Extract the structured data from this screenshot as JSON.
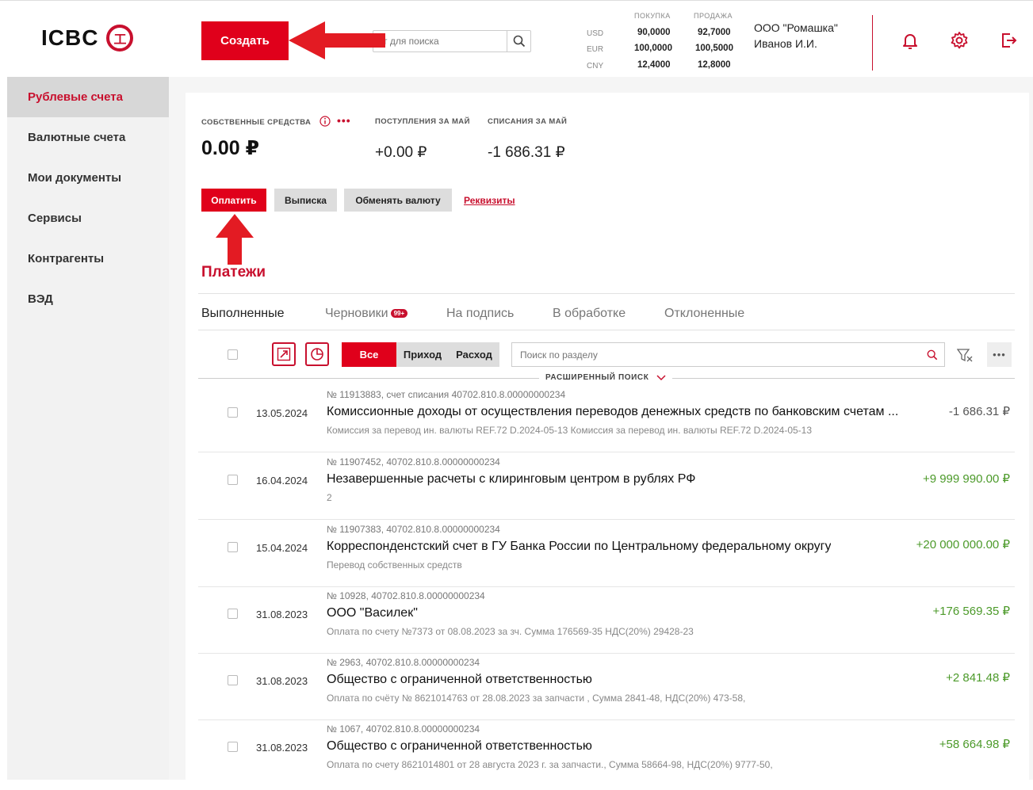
{
  "header": {
    "logo_text": "ICBC",
    "logo_mark": "工",
    "create_label": "Создать",
    "search_placeholder": "т для поиска",
    "rates": {
      "buy_label": "ПОКУПКА",
      "sell_label": "ПРОДАЖА",
      "rows": [
        {
          "currency": "USD",
          "buy": "90,0000",
          "sell": "92,7000"
        },
        {
          "currency": "EUR",
          "buy": "100,0000",
          "sell": "100,5000"
        },
        {
          "currency": "CNY",
          "buy": "12,4000",
          "sell": "12,8000"
        }
      ]
    },
    "company": "ООО \"Ромашка\"",
    "user": "Иванов И.И.",
    "icons": [
      "bell-icon",
      "gear-icon",
      "logout-icon"
    ]
  },
  "sidebar": {
    "items": [
      {
        "label": "Рублевые счета",
        "active": true
      },
      {
        "label": "Валютные счета",
        "active": false
      },
      {
        "label": "Мои документы",
        "active": false
      },
      {
        "label": "Сервисы",
        "active": false
      },
      {
        "label": "Контрагенты",
        "active": false
      },
      {
        "label": "ВЭД",
        "active": false
      }
    ]
  },
  "summary": {
    "own_funds_label": "СОБСТВЕННЫЕ СРЕДСТВА",
    "own_funds_value": "0.00 ₽",
    "income_label": "ПОСТУПЛЕНИЯ ЗА МАЙ",
    "income_value": "+0.00 ₽",
    "outcome_label": "СПИСАНИЯ ЗА МАЙ",
    "outcome_value": "-1 686.31 ₽",
    "more_dots": "•••"
  },
  "actions": {
    "pay": "Оплатить",
    "statement": "Выписка",
    "exchange": "Обменять валюту",
    "requisites": "Реквизиты"
  },
  "payments": {
    "title": "Платежи",
    "tabs": [
      {
        "label": "Выполненные",
        "active": true
      },
      {
        "label": "Черновики",
        "badge": "99+"
      },
      {
        "label": "На подпись"
      },
      {
        "label": "В обработке"
      },
      {
        "label": "Отклоненные"
      }
    ],
    "filter_all": "Все",
    "filter_income": "Приход",
    "filter_outcome": "Расход",
    "section_search_placeholder": "Поиск по разделу",
    "advanced_search": "РАСШИРЕННЫЙ ПОИСК",
    "rows": [
      {
        "number": "№ 11913883, счет списания 40702.810.8.00000000234",
        "date": "13.05.2024",
        "title": "Комиссионные доходы от осуществления переводов денежных средств по банковским счетам ...",
        "desc": "Комиссия за перевод ин. валюты REF.72 D.2024-05-13 Комиссия за перевод ин. валюты REF.72 D.2024-05-13",
        "amount": "-1 686.31 ₽",
        "sign": "neg"
      },
      {
        "number": "№ 11907452, 40702.810.8.00000000234",
        "date": "16.04.2024",
        "title": "Незавершенные расчеты с клиринговым центром в рублях РФ",
        "desc": "2",
        "amount": "+9 999 990.00 ₽",
        "sign": "pos"
      },
      {
        "number": "№ 11907383, 40702.810.8.00000000234",
        "date": "15.04.2024",
        "title": "Корреспонденстский счет в ГУ Банка России по Центральному федеральному округу",
        "desc": "Перевод собственных средств",
        "amount": "+20 000 000.00 ₽",
        "sign": "pos"
      },
      {
        "number": "№ 10928, 40702.810.8.00000000234",
        "date": "31.08.2023",
        "title": "ООО  \"Василек\"",
        "desc": "Оплата по счету №7373 от 08.08.2023 за зч. Сумма 176569-35 НДС(20%) 29428-23",
        "amount": "+176 569.35 ₽",
        "sign": "pos"
      },
      {
        "number": "№ 2963, 40702.810.8.00000000234",
        "date": "31.08.2023",
        "title": "Общество с ограниченной ответственностью",
        "desc": "Оплата по счёту № 8621014763 от 28.08.2023 за запчасти , Сумма 2841-48, НДС(20%) 473-58,",
        "amount": "+2 841.48 ₽",
        "sign": "pos"
      },
      {
        "number": "№ 1067, 40702.810.8.00000000234",
        "date": "31.08.2023",
        "title": "Общество с ограниченной ответственностью",
        "desc": "Оплата по счету 8621014801 от 28 августа 2023 г. за запчасти., Сумма 58664-98, НДС(20%) 9777-50,",
        "amount": "+58 664.98 ₽",
        "sign": "pos"
      }
    ]
  },
  "colors": {
    "accent": "#e0001b",
    "positive": "#4c9a2a"
  }
}
